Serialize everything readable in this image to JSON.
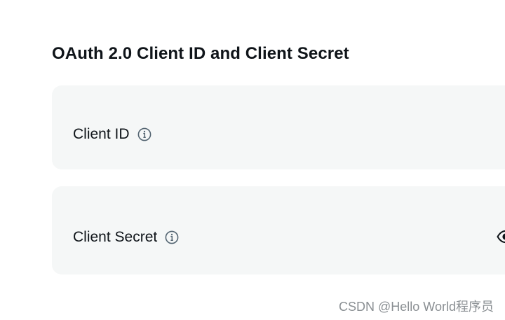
{
  "section": {
    "title": "OAuth 2.0 Client ID and Client Secret"
  },
  "fields": {
    "client_id": {
      "label": "Client ID",
      "icon": "info-icon"
    },
    "client_secret": {
      "label": "Client Secret",
      "icon": "info-icon",
      "toggle_icon": "eye-icon"
    }
  },
  "watermark": {
    "text": "CSDN @Hello World程序员"
  },
  "colors": {
    "card_background": "#f5f7f7",
    "text": "#0f1419",
    "icon": "#536471",
    "watermark": "#8a8f93"
  }
}
